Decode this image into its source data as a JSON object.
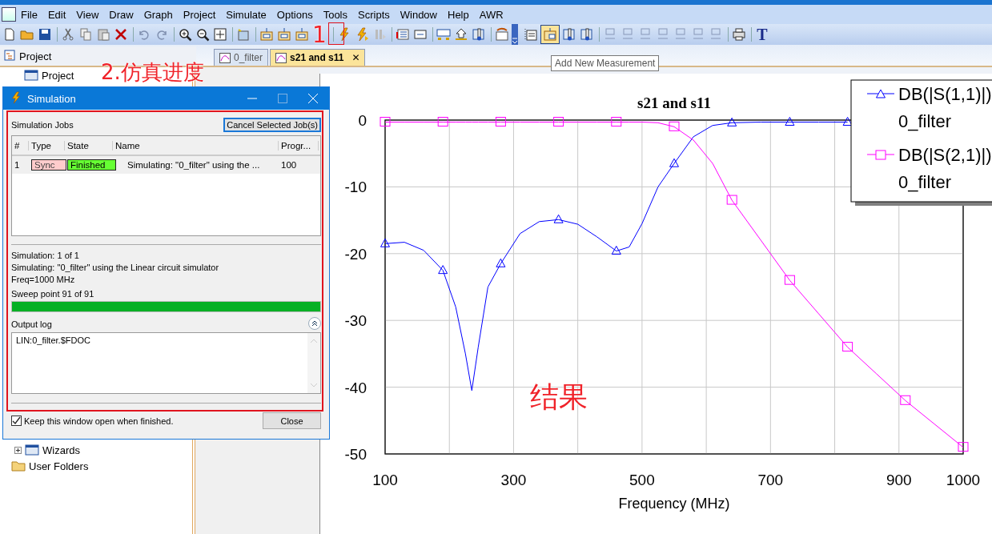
{
  "menu_bar": {
    "items": [
      "File",
      "Edit",
      "View",
      "Draw",
      "Graph",
      "Project",
      "Simulate",
      "Options",
      "Tools",
      "Scripts",
      "Window",
      "Help",
      "AWR"
    ]
  },
  "toolbar": {
    "text_tool": "T",
    "tooltip": "Add New Measurement"
  },
  "project_panel": {
    "title": "Project",
    "tree": [
      {
        "label": "Project",
        "kind": "project"
      },
      {
        "label": "Wizards",
        "kind": "wizards",
        "expanded": false
      },
      {
        "label": "User Folders",
        "kind": "folder"
      }
    ]
  },
  "tabs": [
    {
      "label": "0_filter",
      "selected": false
    },
    {
      "label": "s21 and s11",
      "selected": true,
      "close_glyph": "✕"
    }
  ],
  "simulation_dialog": {
    "title": "Simulation",
    "jobs_label": "Simulation Jobs",
    "cancel_button": "Cancel Selected Job(s)",
    "columns": [
      "#",
      "Type",
      "State",
      "Name",
      "Progr..."
    ],
    "rows": [
      {
        "number": "1",
        "type": "Sync",
        "state": "Finished",
        "name": "Simulating: \"0_filter\" using the ...",
        "progress": "100"
      }
    ],
    "status_lines": [
      "Simulation: 1 of 1",
      "Simulating: \"0_filter\" using the Linear circuit simulator",
      "Freq=1000 MHz"
    ],
    "sweep_label": "Sweep point 91 of 91",
    "level": 1,
    "output_log_label": "Output log",
    "log_text": "LIN:0_filter.$FDOC",
    "keep_open": {
      "label": "Keep this window open when finished.",
      "checked": true
    },
    "close_button": "Close"
  },
  "annotations": [
    {
      "kind": "step",
      "text": "1"
    },
    {
      "kind": "step",
      "text": "2.仿真进度"
    },
    {
      "kind": "result",
      "text": "结果"
    }
  ],
  "graph": {
    "legend_sources": [
      "0_filter",
      "0_filter"
    ],
    "chart_data": {
      "type": "line",
      "title": "s21 and s11",
      "xlabel": "Frequency (MHz)",
      "xlim": [
        100,
        1000
      ],
      "ylim": [
        -50,
        0
      ],
      "xticks": [
        {
          "value": 100,
          "label": "100"
        },
        300,
        500,
        700,
        900,
        1000
      ],
      "yticks": [
        0,
        -10,
        -20,
        -30,
        -40,
        -50
      ],
      "grid": true,
      "legend": "upper right",
      "x": [
        100,
        130,
        160,
        190,
        210,
        225,
        235,
        245,
        260,
        280,
        310,
        340,
        370,
        400,
        430,
        460,
        480,
        500,
        525,
        550,
        580,
        610,
        640,
        685,
        730,
        775,
        820,
        865,
        910,
        955,
        1000
      ],
      "series": [
        {
          "name": "DB(|S(1,1)|)",
          "color": "#0000ff",
          "values": [
            -18.5,
            -18.3,
            -19.5,
            -22.5,
            -28,
            -35,
            -40.5,
            -34,
            -25,
            -21.5,
            -17,
            -15.2,
            -14.9,
            -15.6,
            -17.5,
            -19.6,
            -19,
            -15.5,
            -10,
            -6.5,
            -2.5,
            -0.8,
            -0.4,
            -0.3,
            -0.3,
            -0.3,
            -0.3,
            null,
            null,
            null,
            null
          ]
        },
        {
          "name": "DB(|S(2,1)|)",
          "color": "#ff00ff",
          "values": [
            -0.3,
            -0.3,
            -0.3,
            -0.3,
            -0.3,
            -0.3,
            -0.3,
            -0.3,
            -0.3,
            -0.3,
            -0.3,
            -0.3,
            -0.3,
            -0.3,
            -0.3,
            -0.3,
            -0.3,
            -0.3,
            -0.4,
            -1,
            -3,
            -6.5,
            -12,
            -18,
            -24,
            -29,
            -34,
            -38,
            -42,
            -45.5,
            -49
          ]
        }
      ]
    }
  }
}
